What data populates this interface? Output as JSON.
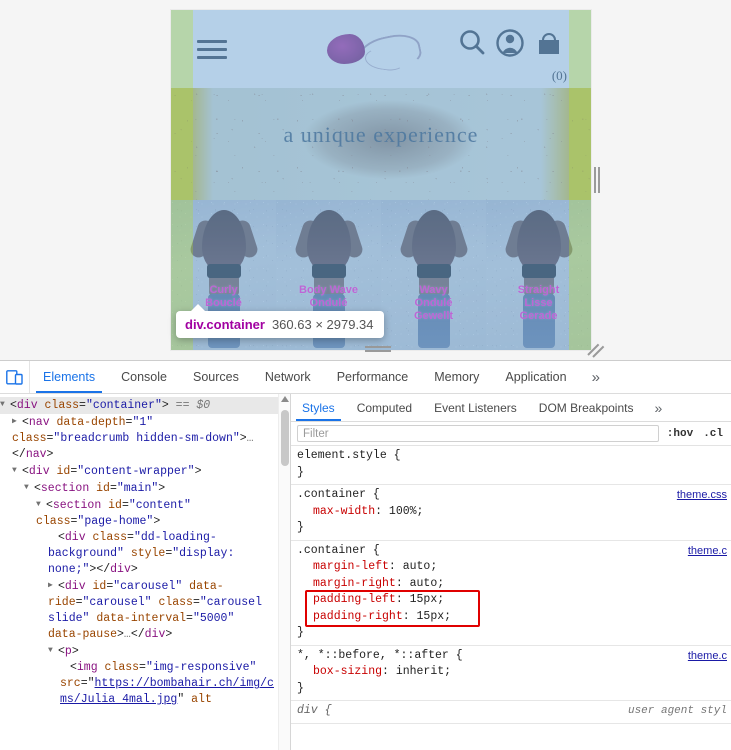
{
  "preview": {
    "site_header": {
      "menu_icon": "hamburger-menu-icon",
      "logo_alt": "bomba hair logo",
      "search_icon": "search-icon",
      "account_icon": "account-icon",
      "cart_icon": "shopping-bag-icon",
      "cart_count": "(0)"
    },
    "hero": {
      "headline": "a unique experience"
    },
    "thumbnails": [
      {
        "lines": [
          "Curly",
          "Bouclé"
        ]
      },
      {
        "lines": [
          "Body Wave",
          "Ondulé"
        ]
      },
      {
        "lines": [
          "Wavy",
          "Ondulé",
          "Gewellt"
        ]
      },
      {
        "lines": [
          "Straight",
          "Lisse",
          "Gerade"
        ]
      }
    ],
    "highlight_tooltip": {
      "tag": "div.container",
      "dimensions": "360.63 × 2979.34"
    },
    "colors": {
      "content_box": "#6fa8dc",
      "padding_box": "#93c47d",
      "tooltip_tag": "#a100a1"
    }
  },
  "devtools": {
    "tabs": [
      {
        "label": "Elements",
        "active": true
      },
      {
        "label": "Console",
        "active": false
      },
      {
        "label": "Sources",
        "active": false
      },
      {
        "label": "Network",
        "active": false
      },
      {
        "label": "Performance",
        "active": false
      },
      {
        "label": "Memory",
        "active": false
      },
      {
        "label": "Application",
        "active": false
      }
    ],
    "more_tabs_icon": "»",
    "device_toolbar_icon": "device-toolbar-icon",
    "accent_color": "#1a73e8",
    "dom": {
      "nodes": [
        {
          "indent": 0,
          "twisty": "▼",
          "selected": true,
          "parts": [
            {
              "t": "pn",
              "v": "<"
            },
            {
              "t": "tg",
              "v": "div"
            },
            {
              "t": "pn",
              "v": " "
            },
            {
              "t": "at",
              "v": "class"
            },
            {
              "t": "pn",
              "v": "="
            },
            {
              "t": "av",
              "v": "\"container\""
            },
            {
              "t": "pn",
              "v": ">"
            },
            {
              "t": "sel",
              "v": " == $0"
            }
          ]
        },
        {
          "indent": 1,
          "twisty": "▶",
          "selected": false,
          "parts": [
            {
              "t": "pn",
              "v": "<"
            },
            {
              "t": "tg",
              "v": "nav"
            },
            {
              "t": "pn",
              "v": " "
            },
            {
              "t": "at",
              "v": "data-depth"
            },
            {
              "t": "pn",
              "v": "="
            },
            {
              "t": "av",
              "v": "\"1\""
            },
            {
              "t": "pn",
              "v": " "
            },
            {
              "t": "at",
              "v": "class"
            },
            {
              "t": "pn",
              "v": "="
            },
            {
              "t": "av",
              "v": "\"breadcrumb hidden-sm-down\""
            },
            {
              "t": "pn",
              "v": ">"
            },
            {
              "t": "ell",
              "v": "…"
            },
            {
              "t": "pn",
              "v": "</"
            },
            {
              "t": "tg",
              "v": "nav"
            },
            {
              "t": "pn",
              "v": ">"
            }
          ]
        },
        {
          "indent": 1,
          "twisty": "▼",
          "selected": false,
          "parts": [
            {
              "t": "pn",
              "v": "<"
            },
            {
              "t": "tg",
              "v": "div"
            },
            {
              "t": "pn",
              "v": " "
            },
            {
              "t": "at",
              "v": "id"
            },
            {
              "t": "pn",
              "v": "="
            },
            {
              "t": "av",
              "v": "\"content-wrapper\""
            },
            {
              "t": "pn",
              "v": ">"
            }
          ]
        },
        {
          "indent": 2,
          "twisty": "▼",
          "selected": false,
          "parts": [
            {
              "t": "pn",
              "v": "<"
            },
            {
              "t": "tg",
              "v": "section"
            },
            {
              "t": "pn",
              "v": " "
            },
            {
              "t": "at",
              "v": "id"
            },
            {
              "t": "pn",
              "v": "="
            },
            {
              "t": "av",
              "v": "\"main\""
            },
            {
              "t": "pn",
              "v": ">"
            }
          ]
        },
        {
          "indent": 3,
          "twisty": "▼",
          "selected": false,
          "parts": [
            {
              "t": "pn",
              "v": "<"
            },
            {
              "t": "tg",
              "v": "section"
            },
            {
              "t": "pn",
              "v": " "
            },
            {
              "t": "at",
              "v": "id"
            },
            {
              "t": "pn",
              "v": "="
            },
            {
              "t": "av",
              "v": "\"content\""
            },
            {
              "t": "pn",
              "v": " "
            },
            {
              "t": "at",
              "v": "class"
            },
            {
              "t": "pn",
              "v": "="
            },
            {
              "t": "av",
              "v": "\"page-home\""
            },
            {
              "t": "pn",
              "v": ">"
            }
          ]
        },
        {
          "indent": 4,
          "twisty": "",
          "selected": false,
          "parts": [
            {
              "t": "pn",
              "v": "<"
            },
            {
              "t": "tg",
              "v": "div"
            },
            {
              "t": "pn",
              "v": " "
            },
            {
              "t": "at",
              "v": "class"
            },
            {
              "t": "pn",
              "v": "="
            },
            {
              "t": "av",
              "v": "\"dd-loading-background\""
            },
            {
              "t": "pn",
              "v": " "
            },
            {
              "t": "at",
              "v": "style"
            },
            {
              "t": "pn",
              "v": "="
            },
            {
              "t": "av",
              "v": "\"display: none;\""
            },
            {
              "t": "pn",
              "v": "></"
            },
            {
              "t": "tg",
              "v": "div"
            },
            {
              "t": "pn",
              "v": ">"
            }
          ]
        },
        {
          "indent": 4,
          "twisty": "▶",
          "selected": false,
          "parts": [
            {
              "t": "pn",
              "v": "<"
            },
            {
              "t": "tg",
              "v": "div"
            },
            {
              "t": "pn",
              "v": " "
            },
            {
              "t": "at",
              "v": "id"
            },
            {
              "t": "pn",
              "v": "="
            },
            {
              "t": "av",
              "v": "\"carousel\""
            },
            {
              "t": "pn",
              "v": " "
            },
            {
              "t": "at",
              "v": "data-ride"
            },
            {
              "t": "pn",
              "v": "="
            },
            {
              "t": "av",
              "v": "\"carousel\""
            },
            {
              "t": "pn",
              "v": " "
            },
            {
              "t": "at",
              "v": "class"
            },
            {
              "t": "pn",
              "v": "="
            },
            {
              "t": "av",
              "v": "\"carousel slide\""
            },
            {
              "t": "pn",
              "v": " "
            },
            {
              "t": "at",
              "v": "data-interval"
            },
            {
              "t": "pn",
              "v": "="
            },
            {
              "t": "av",
              "v": "\"5000\""
            },
            {
              "t": "pn",
              "v": " "
            },
            {
              "t": "at",
              "v": "data-pause"
            },
            {
              "t": "pn",
              "v": ">"
            },
            {
              "t": "ell",
              "v": "…"
            },
            {
              "t": "pn",
              "v": "</"
            },
            {
              "t": "tg",
              "v": "div"
            },
            {
              "t": "pn",
              "v": ">"
            }
          ]
        },
        {
          "indent": 4,
          "twisty": "▼",
          "selected": false,
          "parts": [
            {
              "t": "pn",
              "v": "<"
            },
            {
              "t": "tg",
              "v": "p"
            },
            {
              "t": "pn",
              "v": ">"
            }
          ]
        },
        {
          "indent": 5,
          "twisty": "",
          "selected": false,
          "parts": [
            {
              "t": "pn",
              "v": "<"
            },
            {
              "t": "tg",
              "v": "img"
            },
            {
              "t": "pn",
              "v": " "
            },
            {
              "t": "at",
              "v": "class"
            },
            {
              "t": "pn",
              "v": "="
            },
            {
              "t": "av",
              "v": "\"img-responsive\""
            },
            {
              "t": "pn",
              "v": " "
            },
            {
              "t": "at",
              "v": "src"
            },
            {
              "t": "pn",
              "v": "="
            },
            {
              "t": "pn",
              "v": "\""
            },
            {
              "t": "lnk",
              "v": "https://bombahair.ch/img/cms/Julia 4mal.jpg"
            },
            {
              "t": "pn",
              "v": "\" "
            },
            {
              "t": "at",
              "v": "alt"
            }
          ]
        }
      ]
    },
    "styles": {
      "tabs": [
        {
          "label": "Styles",
          "active": true
        },
        {
          "label": "Computed",
          "active": false
        },
        {
          "label": "Event Listeners",
          "active": false
        },
        {
          "label": "DOM Breakpoints",
          "active": false
        }
      ],
      "more_tabs_icon": "»",
      "filter_placeholder": "Filter",
      "toggle_hov": ":hov",
      "toggle_cls": ".cl",
      "rules": [
        {
          "selector": "element.style",
          "source": "",
          "declarations": []
        },
        {
          "selector": ".container",
          "source": "theme.css",
          "declarations": [
            {
              "prop": "max-width",
              "value": "100%"
            }
          ]
        },
        {
          "selector": ".container",
          "source": "theme.c",
          "declarations": [
            {
              "prop": "margin-left",
              "value": "auto"
            },
            {
              "prop": "margin-right",
              "value": "auto"
            },
            {
              "prop": "padding-left",
              "value": "15px",
              "highlighted": true
            },
            {
              "prop": "padding-right",
              "value": "15px",
              "highlighted": true
            }
          ]
        },
        {
          "selector": "*, *::before, *::after",
          "source": "theme.c",
          "declarations": [
            {
              "prop": "box-sizing",
              "value": "inherit"
            }
          ]
        },
        {
          "selector": "div",
          "source": "user agent styl",
          "user_agent": true,
          "declarations": []
        }
      ],
      "highlight_color": "#e00000"
    }
  }
}
